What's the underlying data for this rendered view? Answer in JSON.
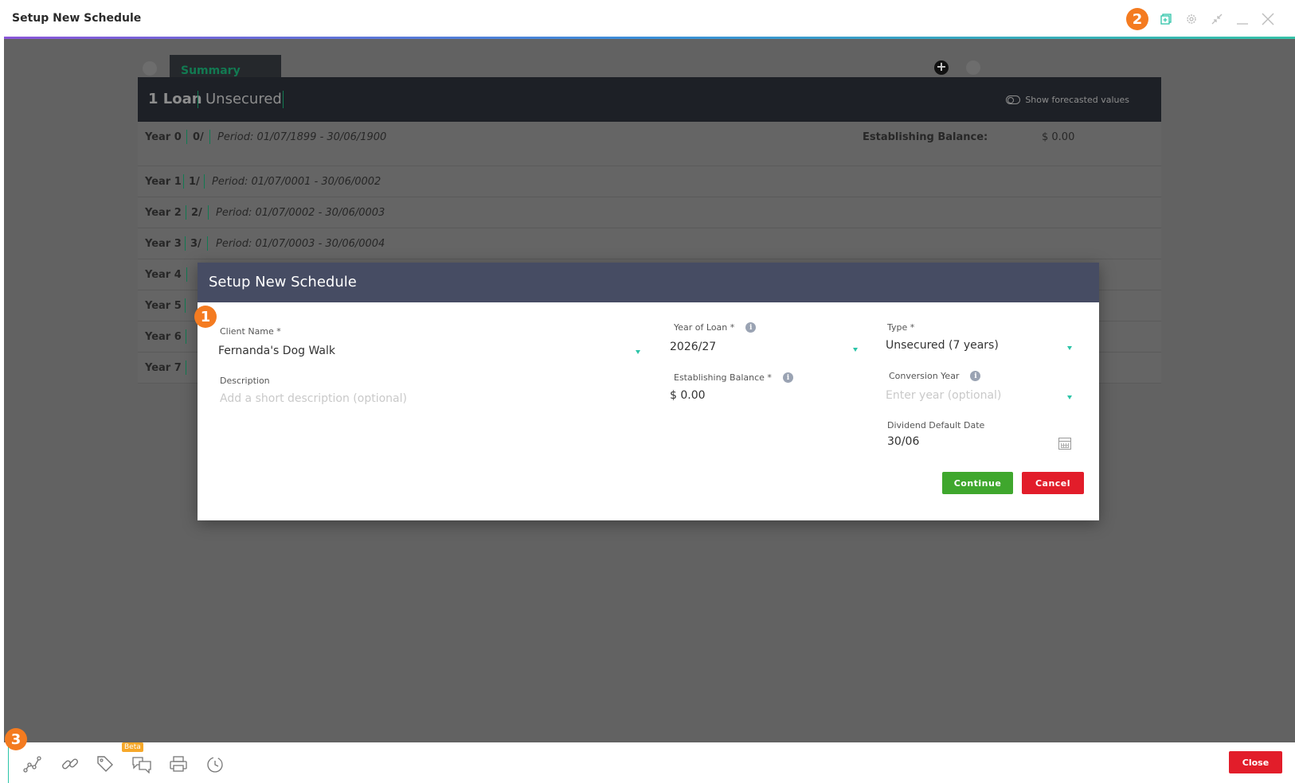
{
  "window": {
    "title": "Setup New Schedule",
    "badge": "2"
  },
  "tabs": {
    "summary_label": "Summary",
    "add_label": "+"
  },
  "loan_header": {
    "count_label": "1 Loan",
    "type_label": "Unsecured",
    "forecast_label": "Show forecasted values"
  },
  "years": [
    {
      "label": "Year 0",
      "short": "0/",
      "period": "Period: 01/07/1899 - 30/06/1900"
    },
    {
      "label": "Year 1",
      "short": "1/",
      "period": "Period: 01/07/0001 - 30/06/0002"
    },
    {
      "label": "Year 2",
      "short": "2/",
      "period": "Period: 01/07/0002 - 30/06/0003"
    },
    {
      "label": "Year 3",
      "short": "3/",
      "period": "Period: 01/07/0003 - 30/06/0004"
    },
    {
      "label": "Year 4"
    },
    {
      "label": "Year 5"
    },
    {
      "label": "Year 6"
    },
    {
      "label": "Year 7"
    }
  ],
  "establishing": {
    "label": "Establishing Balance:",
    "value": "$ 0.00"
  },
  "modal": {
    "title": "Setup New Schedule",
    "badge": "1",
    "client_name_label": "Client Name *",
    "client_name_value": "Fernanda's Dog Walk",
    "description_label": "Description",
    "description_placeholder": "Add a short description (optional)",
    "year_of_loan_label": "Year of Loan *",
    "year_of_loan_value": "2026/27",
    "establishing_balance_label": "Establishing Balance *",
    "establishing_balance_value": "$ 0.00",
    "type_label": "Type *",
    "type_value": "Unsecured (7 years)",
    "conversion_year_label": "Conversion Year",
    "conversion_year_placeholder": "Enter year (optional)",
    "dividend_date_label": "Dividend Default Date",
    "dividend_date_value": "30/06",
    "continue_label": "Continue",
    "cancel_label": "Cancel"
  },
  "bottombar": {
    "badge": "3",
    "beta_label": "Beta",
    "close_label": "Close"
  },
  "colors": {
    "accent_green": "#3fa72d",
    "danger_red": "#e21d2a",
    "teal": "#2cc4a8",
    "modal_header": "#464c63",
    "badge_orange": "#f47b20"
  }
}
